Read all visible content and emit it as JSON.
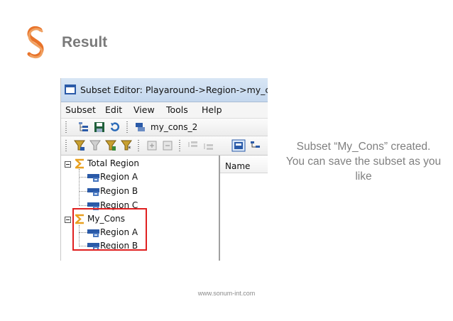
{
  "slide": {
    "title": "Result",
    "caption_line1": "Subset “My_Cons” created.",
    "caption_line2": "You can save the subset as you",
    "caption_line3": "like",
    "footer": "www.sonum-int.com",
    "brand_color": "#e8732a"
  },
  "window": {
    "title": "Subset Editor: Playaround->Region->my_cons_",
    "menu": [
      "Subset",
      "Edit",
      "View",
      "Tools",
      "Help"
    ],
    "subset_name": "my_cons_2",
    "column_header": "Name",
    "tree": [
      {
        "label": "Total Region",
        "type": "consolidated",
        "children": [
          "Region A",
          "Region B",
          "Region C"
        ]
      },
      {
        "label": "My_Cons",
        "type": "consolidated",
        "children": [
          "Region A",
          "Region B"
        ]
      }
    ],
    "highlight_color": "#e02020"
  },
  "icons": {
    "logo": "sonum-s-logo",
    "sigma": "sigma-icon",
    "element": "element-icon",
    "save": "save-icon",
    "refresh": "refresh-icon",
    "filter": "filter-icon"
  }
}
